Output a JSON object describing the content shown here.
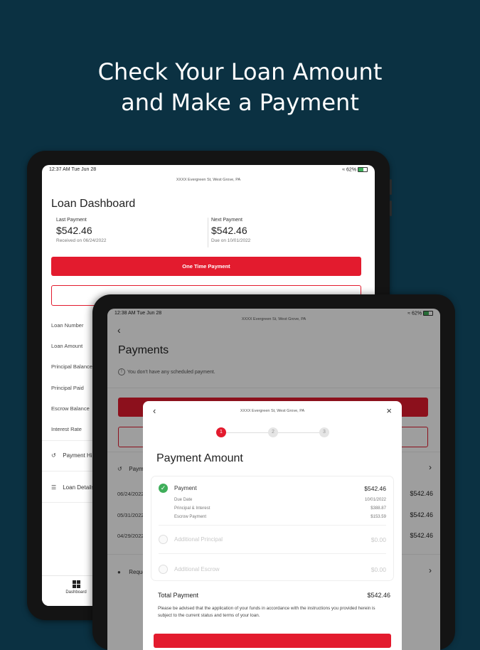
{
  "headline": {
    "line1": "Check Your Loan Amount",
    "line2": "and Make a Payment"
  },
  "back_tablet": {
    "status": {
      "time": "12:37 AM   Tue Jun 28",
      "battery": "62%"
    },
    "address": "XXXX Evergreen St, West Grove, PA",
    "title": "Loan Dashboard",
    "last_payment": {
      "label": "Last Payment",
      "amount": "$542.46",
      "sub": "Received on 06/24/2022"
    },
    "next_payment": {
      "label": "Next Payment",
      "amount": "$542.46",
      "sub": "Due on 10/01/2022"
    },
    "one_time_button": "One Time Payment",
    "rows": [
      "Loan Number",
      "Loan Amount",
      "Principal Balance",
      "Principal Paid",
      "Escrow Balance",
      "Interest Rate"
    ],
    "nav": [
      {
        "icon": "history-icon",
        "label": "Payment History"
      },
      {
        "icon": "list-icon",
        "label": "Loan Details"
      }
    ],
    "tab_dashboard": "Dashboard"
  },
  "front_tablet": {
    "status": {
      "time": "12:38 AM   Tue Jun 28",
      "battery": "62%"
    },
    "address": "XXXX Evergreen St, West Grove, PA",
    "title": "Payments",
    "no_scheduled": "You don't have any scheduled payment.",
    "history_label": "Payment History",
    "history": [
      {
        "date": "06/24/2022",
        "amount": "$542.46"
      },
      {
        "date": "05/31/2022",
        "amount": "$542.46"
      },
      {
        "date": "04/29/2022",
        "amount": "$542.46"
      }
    ],
    "request_label": "Request"
  },
  "modal": {
    "address": "XXXX Evergreen St, West Grove, PA",
    "steps": [
      "1",
      "2",
      "3"
    ],
    "active_step": 1,
    "title": "Payment Amount",
    "payment": {
      "label": "Payment",
      "amount": "$542.46",
      "details": [
        {
          "label": "Due Date",
          "value": "10/01/2022"
        },
        {
          "label": "Principal & Interest",
          "value": "$388.87"
        },
        {
          "label": "Escrow Payment",
          "value": "$153.59"
        }
      ]
    },
    "additional_principal": {
      "label": "Additional Principal",
      "amount": "$0.00"
    },
    "additional_escrow": {
      "label": "Additional Escrow",
      "amount": "$0.00"
    },
    "total_label": "Total Payment",
    "total_amount": "$542.46",
    "disclaimer": "Please be advised that the application of your funds in accordance with the instructions you provided herein is subject to the current status and terms of your loan."
  },
  "colors": {
    "background": "#0b3142",
    "accent": "#e31b2e",
    "success": "#3fae5a"
  }
}
